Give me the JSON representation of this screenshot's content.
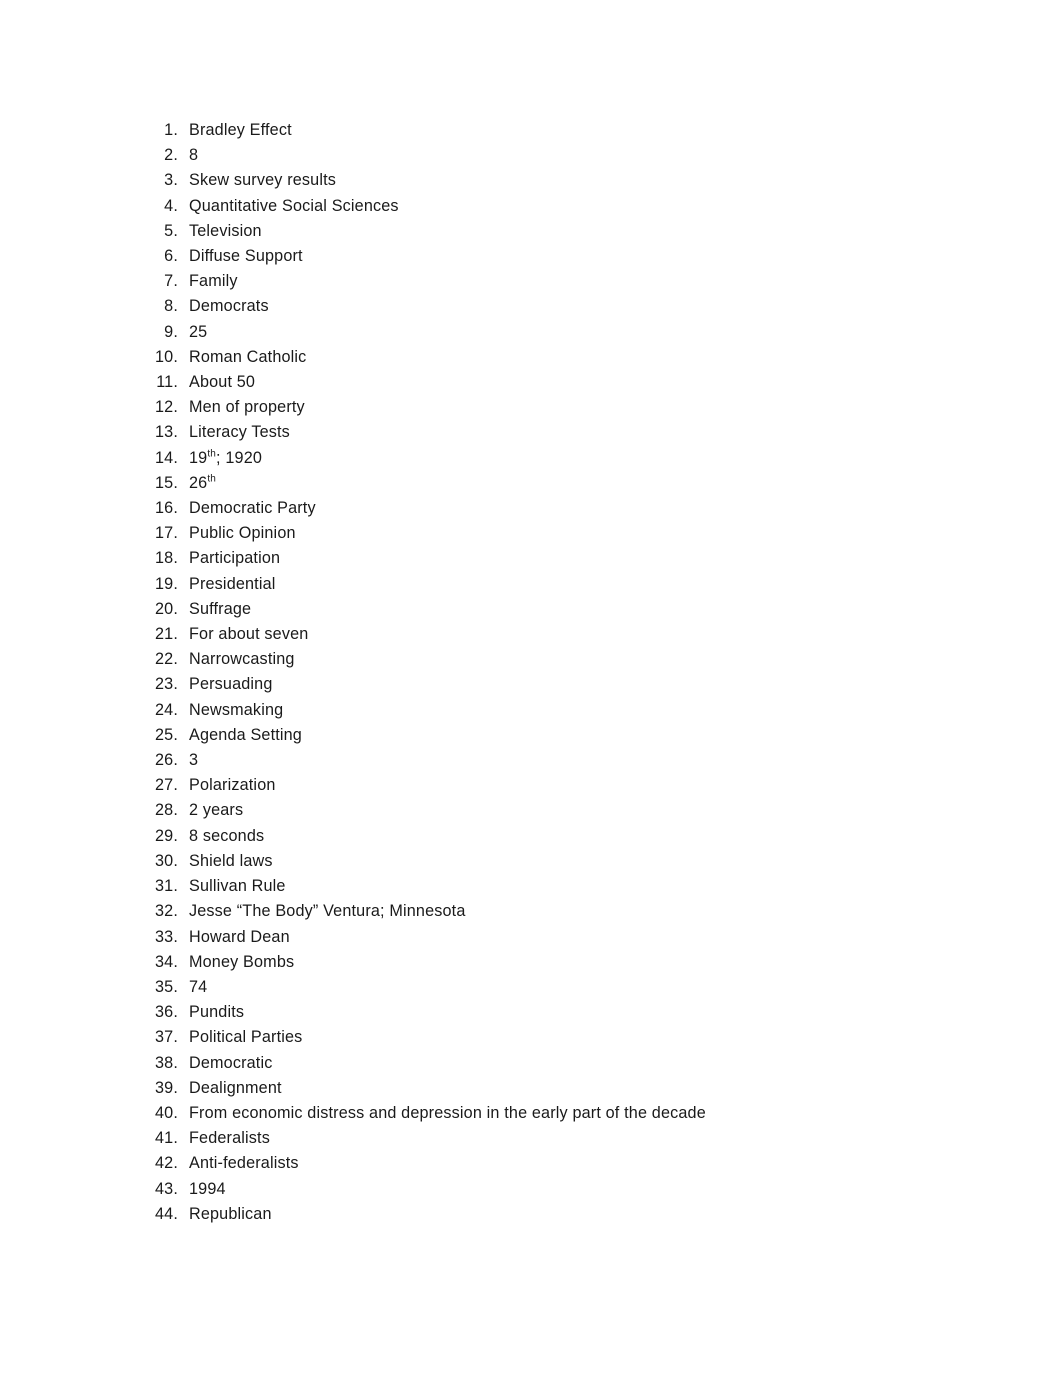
{
  "document": {
    "page_background": "#ffffff",
    "text_color": "#1a1a1a",
    "list": {
      "marker_style": "decimal-period",
      "items": [
        {
          "number": "1.",
          "text": "Bradley Effect"
        },
        {
          "number": "2.",
          "text": "8"
        },
        {
          "number": "3.",
          "text": "Skew survey results"
        },
        {
          "number": "4.",
          "text": "Quantitative Social Sciences"
        },
        {
          "number": "5.",
          "text": "Television"
        },
        {
          "number": "6.",
          "text": "Diffuse Support"
        },
        {
          "number": "7.",
          "text": "Family"
        },
        {
          "number": "8.",
          "text": "Democrats"
        },
        {
          "number": "9.",
          "text": "25"
        },
        {
          "number": "10.",
          "text": "Roman Catholic"
        },
        {
          "number": "11.",
          "text": "About 50"
        },
        {
          "number": "12.",
          "text": "Men of property"
        },
        {
          "number": "13.",
          "text": "Literacy Tests"
        },
        {
          "number": "14.",
          "text": "19th; 1920",
          "html": "19<sup>th</sup>; 1920"
        },
        {
          "number": "15.",
          "text": "26th",
          "html": "26<sup>th</sup>"
        },
        {
          "number": "16.",
          "text": "Democratic Party"
        },
        {
          "number": "17.",
          "text": "Public Opinion"
        },
        {
          "number": "18.",
          "text": "Participation"
        },
        {
          "number": "19.",
          "text": "Presidential"
        },
        {
          "number": "20.",
          "text": "Suffrage"
        },
        {
          "number": "21.",
          "text": "For about seven"
        },
        {
          "number": "22.",
          "text": "Narrowcasting"
        },
        {
          "number": "23.",
          "text": "Persuading"
        },
        {
          "number": "24.",
          "text": "Newsmaking"
        },
        {
          "number": "25.",
          "text": "Agenda Setting"
        },
        {
          "number": "26.",
          "text": "3"
        },
        {
          "number": "27.",
          "text": "Polarization"
        },
        {
          "number": "28.",
          "text": "2 years"
        },
        {
          "number": "29.",
          "text": "8 seconds"
        },
        {
          "number": "30.",
          "text": "Shield laws"
        },
        {
          "number": "31.",
          "text": "Sullivan Rule"
        },
        {
          "number": "32.",
          "text": "Jesse “The Body” Ventura; Minnesota"
        },
        {
          "number": "33.",
          "text": "Howard Dean"
        },
        {
          "number": "34.",
          "text": "Money Bombs"
        },
        {
          "number": "35.",
          "text": "74"
        },
        {
          "number": "36.",
          "text": "Pundits"
        },
        {
          "number": "37.",
          "text": "Political Parties"
        },
        {
          "number": "38.",
          "text": "Democratic"
        },
        {
          "number": "39.",
          "text": "Dealignment"
        },
        {
          "number": "40.",
          "text": "From economic distress and depression in the early part of the decade"
        },
        {
          "number": "41.",
          "text": "Federalists"
        },
        {
          "number": "42.",
          "text": "Anti-federalists"
        },
        {
          "number": "43.",
          "text": "1994"
        },
        {
          "number": "44.",
          "text": "Republican"
        }
      ]
    }
  }
}
